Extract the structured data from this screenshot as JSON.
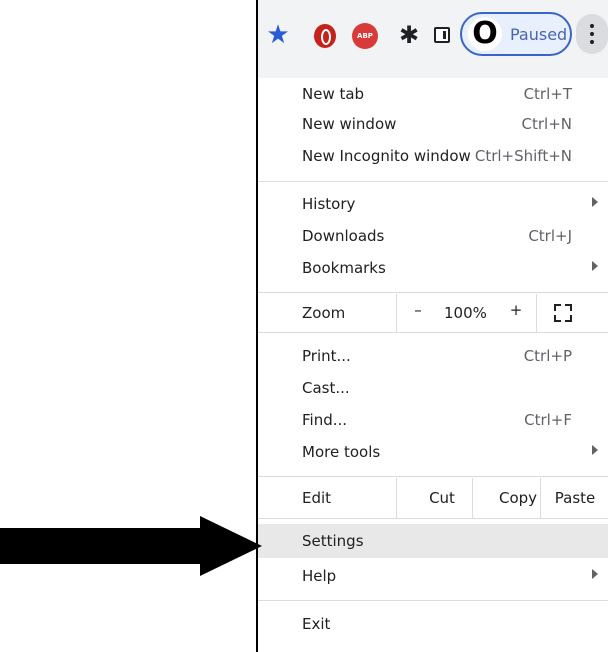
{
  "toolbar": {
    "icons": [
      "star-icon",
      "opera-icon",
      "abp-icon",
      "puzzle-icon",
      "side-panel-icon",
      "menu-dots-icon"
    ],
    "abp_text": "ABP",
    "profile": {
      "avatar_letter": "O",
      "status": "Paused"
    },
    "accent_color": "#3a64c8"
  },
  "menu": {
    "new_tab": {
      "label": "New tab",
      "shortcut": "Ctrl+T"
    },
    "new_window": {
      "label": "New window",
      "shortcut": "Ctrl+N"
    },
    "new_incognito": {
      "label": "New Incognito window",
      "shortcut": "Ctrl+Shift+N"
    },
    "history": {
      "label": "History"
    },
    "downloads": {
      "label": "Downloads",
      "shortcut": "Ctrl+J"
    },
    "bookmarks": {
      "label": "Bookmarks"
    },
    "zoom": {
      "label": "Zoom",
      "minus": "–",
      "level": "100%",
      "plus": "+"
    },
    "print": {
      "label": "Print...",
      "shortcut": "Ctrl+P"
    },
    "cast": {
      "label": "Cast..."
    },
    "find": {
      "label": "Find...",
      "shortcut": "Ctrl+F"
    },
    "more_tools": {
      "label": "More tools"
    },
    "edit": {
      "label": "Edit",
      "cut": "Cut",
      "copy": "Copy",
      "paste": "Paste"
    },
    "settings": {
      "label": "Settings"
    },
    "help": {
      "label": "Help"
    },
    "exit": {
      "label": "Exit"
    },
    "highlight_color": "#e8e8e8"
  }
}
